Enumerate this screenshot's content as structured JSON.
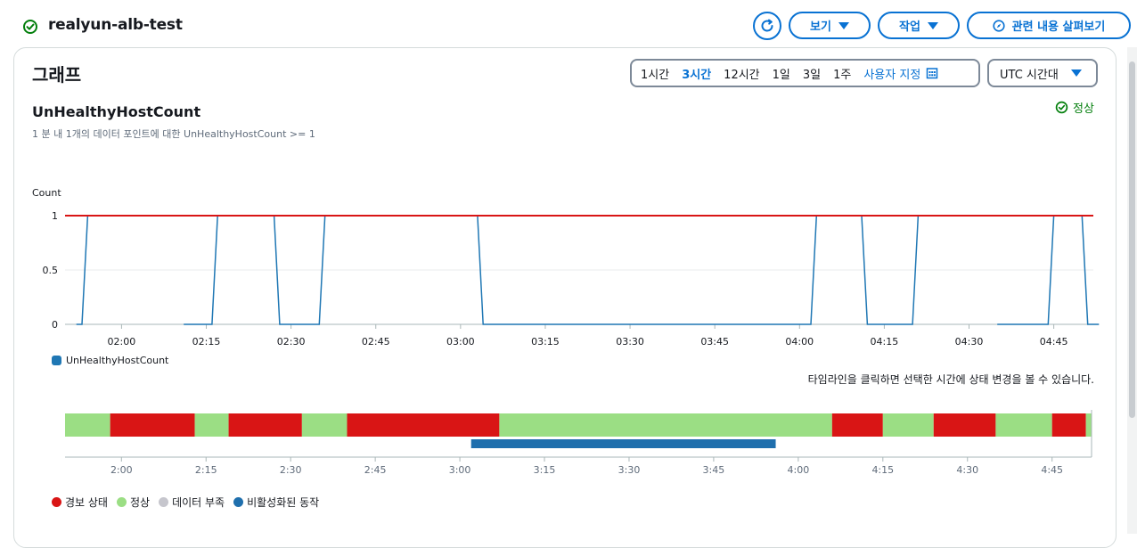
{
  "header": {
    "alarm_name": "realyun-alb-test",
    "buttons": {
      "view": "보기",
      "actions": "작업",
      "explore_related": "관련 내용 살펴보기"
    }
  },
  "graph": {
    "title": "그래프",
    "time_ranges": [
      "1시간",
      "3시간",
      "12시간",
      "1일",
      "3일",
      "1주"
    ],
    "active_range": "3시간",
    "custom_range_label": "사용자 지정",
    "timezone": "UTC 시간대",
    "metric_title": "UnHealthyHostCount",
    "metric_subtitle": "1 분 내 1개의 데이터 포인트에 대한 UnHealthyHostCount >= 1",
    "state_label": "정상",
    "legend_label": "UnHealthyHostCount",
    "timeline_hint": "타임라인을 클릭하면 선택한 시간에 상태 변경을 볼 수 있습니다."
  },
  "chart_data": {
    "type": "line",
    "ylabel": "Count",
    "yticks": [
      0,
      0.5,
      1
    ],
    "ylim": [
      0,
      1
    ],
    "xlim": [
      "01:50",
      "04:52"
    ],
    "xticks": [
      "02:00",
      "02:15",
      "02:30",
      "02:45",
      "03:00",
      "03:15",
      "03:30",
      "03:45",
      "04:00",
      "04:15",
      "04:30",
      "04:45"
    ],
    "threshold": 1,
    "series": [
      {
        "name": "UnHealthyHostCount",
        "color": "#1f77b4",
        "segments": [
          [
            [
              "01:52",
              0
            ],
            [
              "01:53",
              0
            ],
            [
              "01:54",
              1
            ],
            [
              "02:15",
              1
            ]
          ],
          [
            [
              "02:11",
              0
            ],
            [
              "02:16",
              0
            ],
            [
              "02:17",
              1
            ],
            [
              "02:27",
              1
            ],
            [
              "02:28",
              0
            ],
            [
              "02:35",
              0
            ],
            [
              "02:36",
              1
            ],
            [
              "03:03",
              1
            ],
            [
              "03:04",
              0
            ],
            [
              "04:02",
              0
            ],
            [
              "04:03",
              1
            ],
            [
              "04:11",
              1
            ],
            [
              "04:12",
              0
            ],
            [
              "04:20",
              0
            ],
            [
              "04:21",
              1
            ],
            [
              "04:23",
              1
            ]
          ],
          [
            [
              "04:35",
              0
            ],
            [
              "04:44",
              0
            ],
            [
              "04:45",
              1
            ],
            [
              "04:50",
              1
            ],
            [
              "04:51",
              0
            ],
            [
              "04:53",
              0
            ]
          ]
        ]
      }
    ],
    "threshold_color": "#d91515"
  },
  "timeline": {
    "xticks": [
      "2:00",
      "2:15",
      "2:30",
      "2:45",
      "3:00",
      "3:15",
      "3:30",
      "3:45",
      "4:00",
      "4:15",
      "4:30",
      "4:45"
    ],
    "states": [
      {
        "start": "01:50",
        "end": "01:58",
        "state": "ok"
      },
      {
        "start": "01:58",
        "end": "02:13",
        "state": "alarm"
      },
      {
        "start": "02:13",
        "end": "02:19",
        "state": "ok"
      },
      {
        "start": "02:19",
        "end": "02:32",
        "state": "alarm"
      },
      {
        "start": "02:32",
        "end": "02:40",
        "state": "ok"
      },
      {
        "start": "02:40",
        "end": "03:07",
        "state": "alarm"
      },
      {
        "start": "03:07",
        "end": "04:06",
        "state": "ok"
      },
      {
        "start": "04:06",
        "end": "04:15",
        "state": "alarm"
      },
      {
        "start": "04:15",
        "end": "04:24",
        "state": "ok"
      },
      {
        "start": "04:24",
        "end": "04:35",
        "state": "alarm"
      },
      {
        "start": "04:35",
        "end": "04:45",
        "state": "ok"
      },
      {
        "start": "04:45",
        "end": "04:51",
        "state": "alarm"
      },
      {
        "start": "04:51",
        "end": "04:52",
        "state": "ok"
      }
    ],
    "disabled_actions": {
      "start": "03:02",
      "end": "03:56"
    },
    "legend": [
      {
        "label": "경보 상태",
        "color": "#d91515"
      },
      {
        "label": "정상",
        "color": "#9bde84"
      },
      {
        "label": "데이터 부족",
        "color": "#c6c6cd"
      },
      {
        "label": "비활성화된 동작",
        "color": "#1f6fad"
      }
    ]
  },
  "colors": {
    "accent": "#0972d3",
    "ok": "#037f0c",
    "alarm": "#d91515"
  }
}
